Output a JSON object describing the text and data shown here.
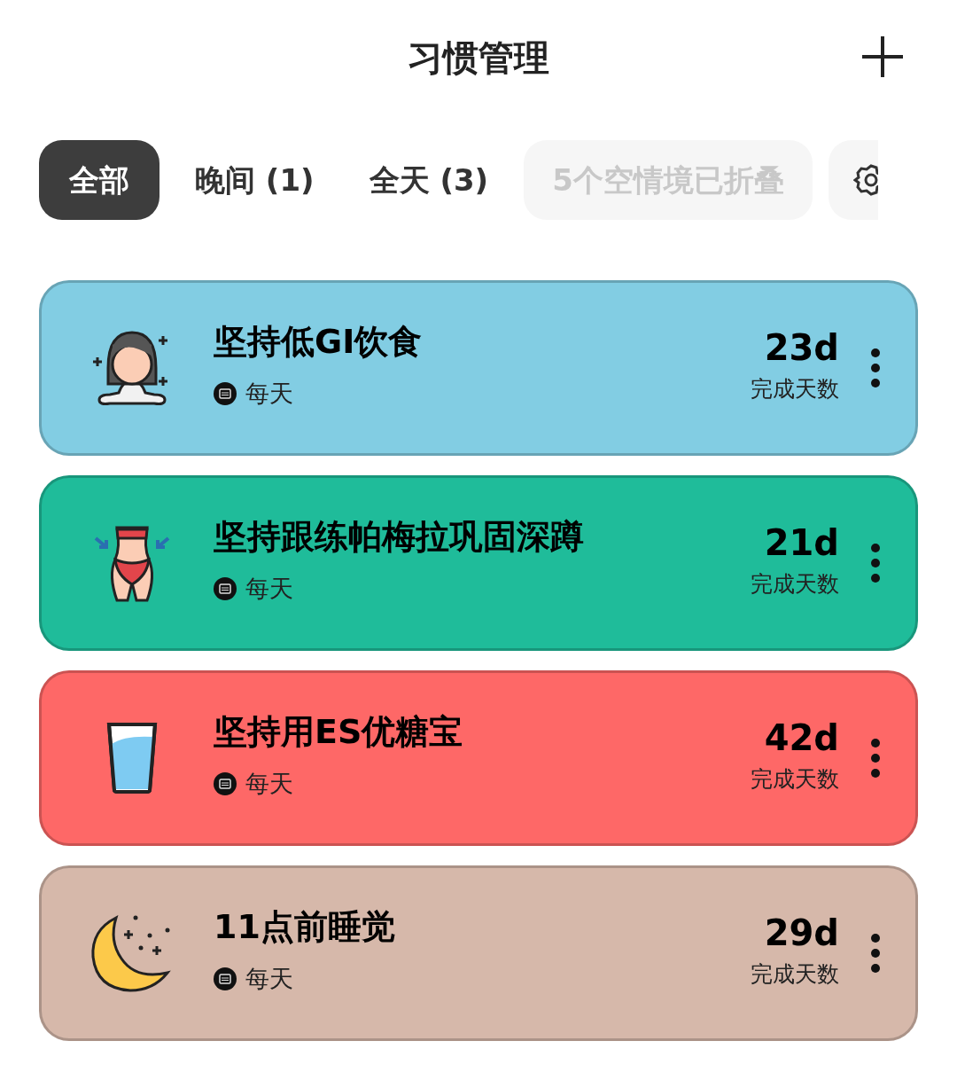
{
  "header": {
    "title": "习惯管理"
  },
  "tabs": [
    {
      "label": "全部",
      "selected": true
    },
    {
      "label": "晚间 (1)",
      "selected": false
    },
    {
      "label": "全天 (3)",
      "selected": false
    }
  ],
  "collapsed_chip": {
    "label": "5个空情境已折叠",
    "disabled": true
  },
  "habits": [
    {
      "kind": "meditation",
      "title": "坚持低GI饮食",
      "frequency": "每天",
      "days": "23d",
      "days_label": "完成天数",
      "color": "#82cde3"
    },
    {
      "kind": "waist",
      "title": "坚持跟练帕梅拉巩固深蹲",
      "frequency": "每天",
      "days": "21d",
      "days_label": "完成天数",
      "color": "#1fbc9a"
    },
    {
      "kind": "glass",
      "title": "坚持用ES优糖宝",
      "frequency": "每天",
      "days": "42d",
      "days_label": "完成天数",
      "color": "#fe6867"
    },
    {
      "kind": "moon",
      "title": "11点前睡觉",
      "frequency": "每天",
      "days": "29d",
      "days_label": "完成天数",
      "color": "#d6b8aa"
    }
  ]
}
